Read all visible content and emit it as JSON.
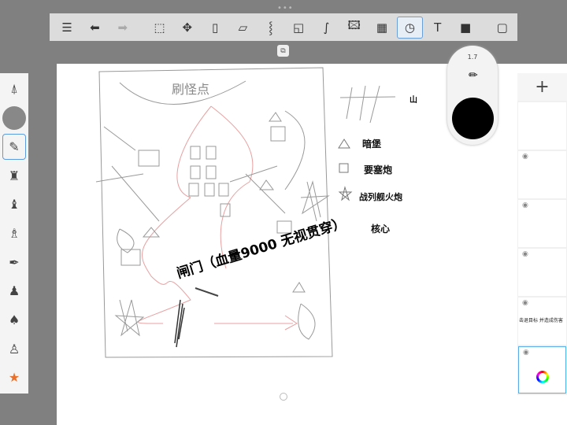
{
  "toolbar": {
    "items": [
      {
        "name": "list-icon",
        "glyph": "☰"
      },
      {
        "name": "undo-icon",
        "glyph": "⬅"
      },
      {
        "name": "redo-icon",
        "glyph": "➡"
      },
      {
        "name": "selection-icon",
        "glyph": "⬚"
      },
      {
        "name": "transform-icon",
        "glyph": "✥"
      },
      {
        "name": "fill-icon",
        "glyph": "▯"
      },
      {
        "name": "ruler-icon",
        "glyph": "▱"
      },
      {
        "name": "symmetry-icon",
        "glyph": "⸾"
      },
      {
        "name": "shape-icon",
        "glyph": "◱"
      },
      {
        "name": "stroke-icon",
        "glyph": "∫"
      },
      {
        "name": "add-image-icon",
        "glyph": "🖾"
      },
      {
        "name": "perspective-icon",
        "glyph": "▦"
      },
      {
        "name": "time-lapse-icon",
        "glyph": "◷"
      },
      {
        "name": "text-icon",
        "glyph": "T"
      },
      {
        "name": "video-icon",
        "glyph": "■"
      },
      {
        "name": "fullscreen-icon",
        "glyph": "▢"
      }
    ]
  },
  "brush": {
    "size": "1.7",
    "color": "#000000"
  },
  "layers": {
    "add": "+",
    "items": [
      {
        "text": ""
      },
      {
        "text": ""
      },
      {
        "text": ""
      },
      {
        "text": ""
      },
      {
        "text": "击退目标 并造成伤害"
      },
      {
        "text": ""
      }
    ]
  },
  "legend": {
    "mountain": "山",
    "bunker": "暗堡",
    "fortress": "要塞炮",
    "battleship": "战列舰火炮",
    "core": "核心"
  },
  "sketch": {
    "spawn": "刷怪点",
    "gate": "闸门（血量9000 无视贯穿）"
  },
  "colors": {
    "accent": "#5b9be0",
    "background": "#808080"
  }
}
